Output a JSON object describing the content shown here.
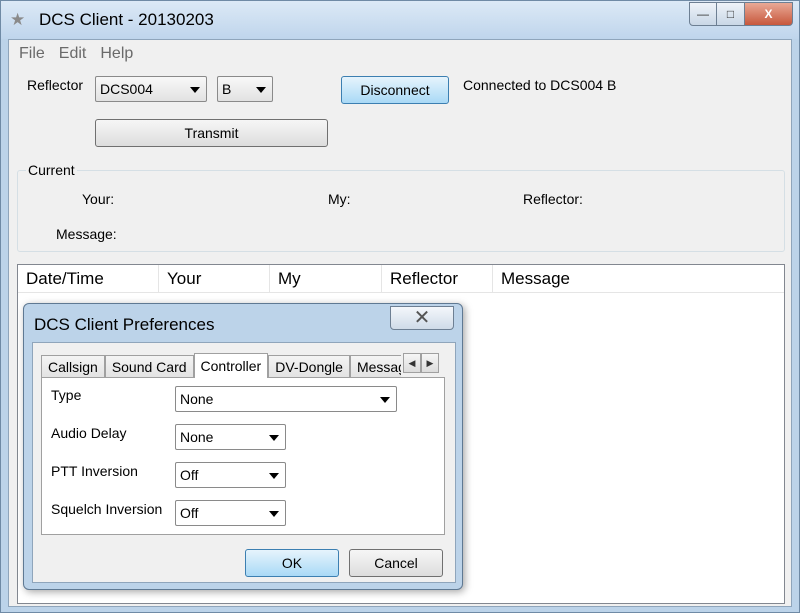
{
  "window": {
    "title": "DCS Client - 20130203",
    "minimize_glyph": "—",
    "maximize_glyph": "□",
    "close_glyph": "X"
  },
  "menu": [
    "File",
    "Edit",
    "Help"
  ],
  "reflector": {
    "label": "Reflector",
    "reflector_value": "DCS004",
    "module_value": "B",
    "disconnect_label": "Disconnect",
    "status": "Connected to DCS004 B",
    "transmit_label": "Transmit"
  },
  "current": {
    "title": "Current",
    "your_label": "Your:",
    "my_label": "My:",
    "reflector_label": "Reflector:",
    "message_label": "Message:"
  },
  "list": {
    "columns": [
      "Date/Time",
      "Your",
      "My",
      "Reflector",
      "Message"
    ]
  },
  "dialog": {
    "title": "DCS Client Preferences",
    "close_glyph": "✕",
    "tabs": [
      "Callsign",
      "Sound Card",
      "Controller",
      "DV-Dongle",
      "Messag"
    ],
    "active_tab": "Controller",
    "fields": {
      "type_label": "Type",
      "type_value": "None",
      "audio_delay_label": "Audio Delay",
      "audio_delay_value": "None",
      "ptt_label": "PTT Inversion",
      "ptt_value": "Off",
      "squelch_label": "Squelch Inversion",
      "squelch_value": "Off"
    },
    "ok_label": "OK",
    "cancel_label": "Cancel"
  },
  "icons": {
    "app": "star-icon",
    "dropdown": "chevron-down-icon",
    "tab_left": "arrow-left-icon",
    "tab_right": "arrow-right-icon"
  }
}
